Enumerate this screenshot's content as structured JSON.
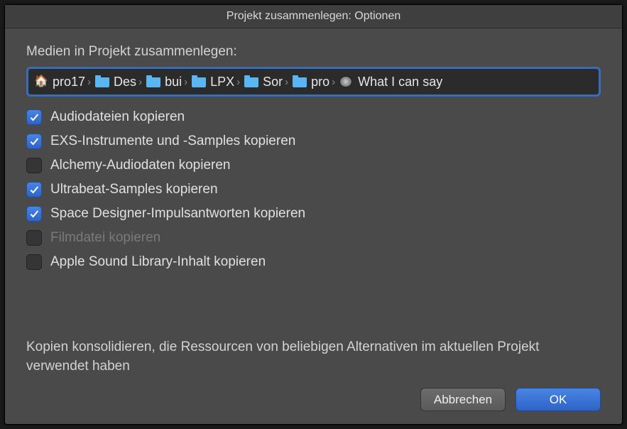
{
  "window": {
    "title": "Projekt zusammenlegen: Optionen"
  },
  "section_label": "Medien in Projekt zusammenlegen:",
  "breadcrumb": {
    "items": [
      {
        "icon": "home",
        "label": "pro17"
      },
      {
        "icon": "folder",
        "label": "Des"
      },
      {
        "icon": "folder",
        "label": "bui"
      },
      {
        "icon": "folder",
        "label": "LPX"
      },
      {
        "icon": "folder",
        "label": "Sor"
      },
      {
        "icon": "folder",
        "label": "pro"
      },
      {
        "icon": "project",
        "label": "What I can say"
      }
    ]
  },
  "options": [
    {
      "label": "Audiodateien kopieren",
      "checked": true,
      "disabled": false
    },
    {
      "label": "EXS-Instrumente und -Samples kopieren",
      "checked": true,
      "disabled": false
    },
    {
      "label": "Alchemy-Audiodaten kopieren",
      "checked": false,
      "disabled": false
    },
    {
      "label": "Ultrabeat-Samples kopieren",
      "checked": true,
      "disabled": false
    },
    {
      "label": "Space Designer-Impulsantworten kopieren",
      "checked": true,
      "disabled": false
    },
    {
      "label": "Filmdatei kopieren",
      "checked": false,
      "disabled": true
    },
    {
      "label": "Apple Sound Library-Inhalt kopieren",
      "checked": false,
      "disabled": false
    }
  ],
  "description": "Kopien konsolidieren, die Ressourcen von beliebigen Alternativen im aktuellen Projekt verwendet haben",
  "buttons": {
    "cancel": "Abbrechen",
    "ok": "OK"
  }
}
